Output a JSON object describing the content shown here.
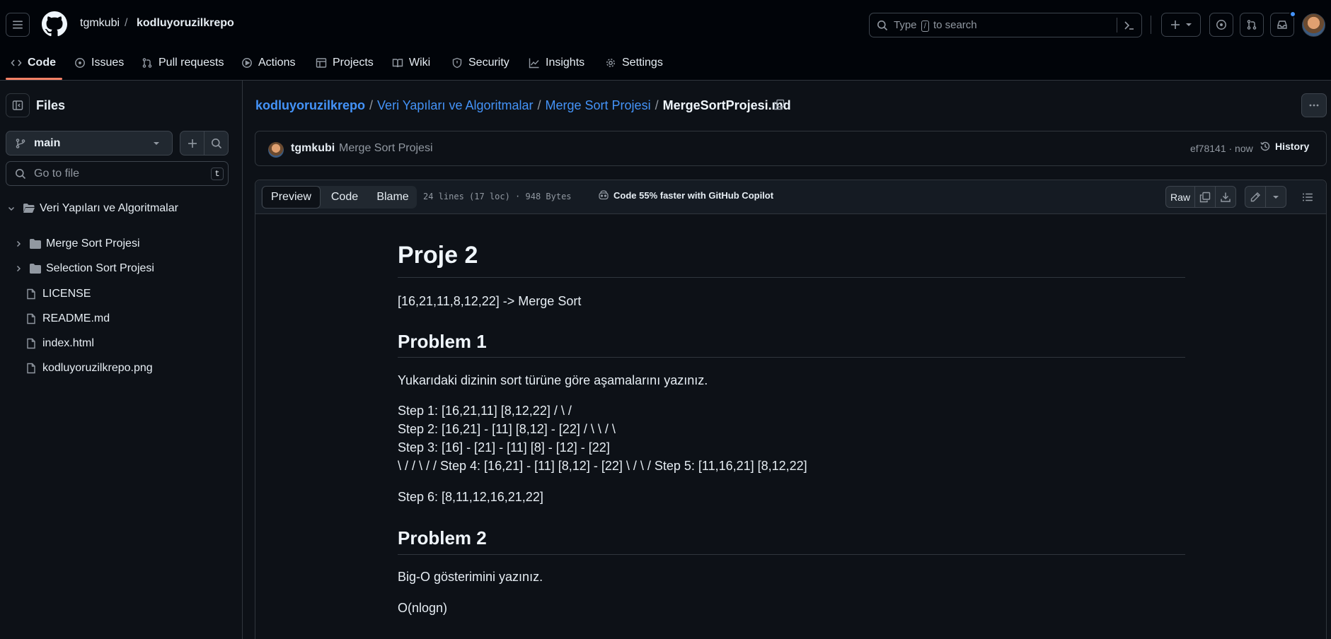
{
  "header": {
    "owner": "tgmkubi",
    "separator": "/",
    "repo": "kodluyoruzilkrepo",
    "search_placeholder_pre": "Type",
    "search_key": "/",
    "search_placeholder_post": "to search",
    "accent_color": "#f78166",
    "notification_dot_color": "#4493f8"
  },
  "nav": {
    "tabs": [
      {
        "label": "Code",
        "icon": "code-icon",
        "active": true
      },
      {
        "label": "Issues",
        "icon": "issue-icon"
      },
      {
        "label": "Pull requests",
        "icon": "pull-request-icon"
      },
      {
        "label": "Actions",
        "icon": "play-icon"
      },
      {
        "label": "Projects",
        "icon": "table-icon"
      },
      {
        "label": "Wiki",
        "icon": "book-icon"
      },
      {
        "label": "Security",
        "icon": "shield-icon"
      },
      {
        "label": "Insights",
        "icon": "graph-icon"
      },
      {
        "label": "Settings",
        "icon": "gear-icon"
      }
    ]
  },
  "sidebar": {
    "title": "Files",
    "branch": "main",
    "file_search_placeholder": "Go to file",
    "file_search_key": "t",
    "tree": [
      {
        "label": "Veri Yapıları ve Algoritmalar",
        "type": "folder-open"
      },
      {
        "label": "Merge Sort Projesi",
        "type": "folder"
      },
      {
        "label": "Selection Sort Projesi",
        "type": "folder"
      },
      {
        "label": "LICENSE",
        "type": "file"
      },
      {
        "label": "README.md",
        "type": "file"
      },
      {
        "label": "index.html",
        "type": "file"
      },
      {
        "label": "kodluyoruzilkrepo.png",
        "type": "file"
      }
    ]
  },
  "breadcrumb": {
    "parts": [
      "kodluyoruzilkrepo",
      "Veri Yapıları ve Algoritmalar",
      "Merge Sort Projesi"
    ],
    "file": "MergeSortProjesi.md",
    "sep": "/"
  },
  "commit": {
    "author": "tgmkubi",
    "message": "Merge Sort Projesi",
    "sha_time": "ef78141 · now",
    "history_label": "History"
  },
  "file_header": {
    "tabs": [
      "Preview",
      "Code",
      "Blame"
    ],
    "active_tab": "Preview",
    "meta": "24 lines (17 loc) · 948 Bytes",
    "copilot": "Code 55% faster with GitHub Copilot",
    "raw_label": "Raw"
  },
  "markdown": {
    "h1": "Proje 2",
    "intro": "[16,21,11,8,12,22] -> Merge Sort",
    "problem1_title": "Problem 1",
    "problem1_text": "Yukarıdaki dizinin sort türüne göre aşamalarını yazınız.",
    "steps": [
      "Step 1: [16,21,11] [8,12,22] / \\ /",
      "Step 2: [16,21] - [11] [8,12] - [22] / \\ \\ / \\",
      "Step 3: [16] - [21] - [11] [8] - [12] - [22]",
      "\\ / / \\ / / Step 4: [16,21] - [11] [8,12] - [22] \\ / \\ / Step 5: [11,16,21] [8,12,22]"
    ],
    "step6": "Step 6: [8,11,12,16,21,22]",
    "problem2_title": "Problem 2",
    "problem2_text": "Big-O gösterimini yazınız.",
    "answer": "O(nlogn)"
  }
}
